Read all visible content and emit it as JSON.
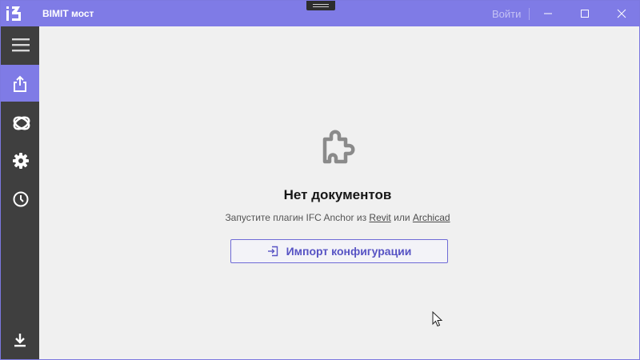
{
  "titlebar": {
    "app_name": "BIMIT мост",
    "login_label": "Войти",
    "accent_color": "#7f7be6"
  },
  "window_controls": [
    "minimize-icon",
    "maximize-icon",
    "close-icon"
  ],
  "sidebar": {
    "background": "#3f3f3f",
    "items": [
      {
        "icon": "menu-icon",
        "active": false
      },
      {
        "icon": "share-export-icon",
        "active": true
      },
      {
        "icon": "ifc-logo-icon",
        "active": false
      },
      {
        "icon": "gear-icon",
        "active": false
      },
      {
        "icon": "clock-icon",
        "active": false
      }
    ],
    "bottom_item": {
      "icon": "download-icon"
    }
  },
  "main": {
    "empty_icon": "puzzle-icon",
    "empty_title": "Нет документов",
    "hint": {
      "prefix": "Запустите плагин IFC Anchor из",
      "link1": "Revit",
      "middle": "или",
      "link2": "Archicad"
    },
    "import_button_label": "Импорт конфигурации"
  }
}
